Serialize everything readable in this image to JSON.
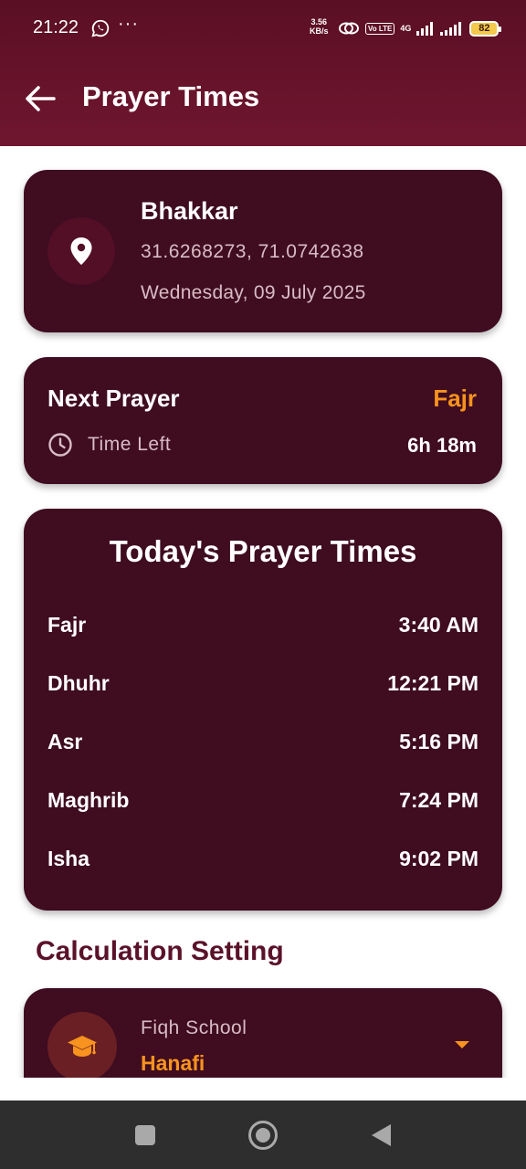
{
  "status_bar": {
    "time": "21:22",
    "more": "···",
    "net_speed_value": "3.56",
    "net_speed_unit": "KB/s",
    "volte_label": "Vo LTE",
    "network_type": "4G",
    "battery_level": "82"
  },
  "header": {
    "title": "Prayer Times"
  },
  "location": {
    "city": "Bhakkar",
    "coordinates": "31.6268273, 71.0742638",
    "date": "Wednesday, 09 July 2025"
  },
  "next_prayer": {
    "label": "Next Prayer",
    "name": "Fajr",
    "time_left_label": "Time Left",
    "time_left_value": "6h 18m"
  },
  "todays_times": {
    "title": "Today's Prayer Times",
    "rows": [
      {
        "name": "Fajr",
        "time": "3:40 AM"
      },
      {
        "name": "Dhuhr",
        "time": "12:21 PM"
      },
      {
        "name": "Asr",
        "time": "5:16 PM"
      },
      {
        "name": "Maghrib",
        "time": "7:24 PM"
      },
      {
        "name": "Isha",
        "time": "9:02 PM"
      }
    ]
  },
  "calculation": {
    "section_title": "Calculation Setting",
    "fiqh_label": "Fiqh School",
    "fiqh_value": "Hanafi"
  },
  "colors": {
    "header_bg": "#701630",
    "card_bg": "#3f0c20",
    "accent_orange": "#f7931e",
    "section_title": "#5a1229"
  },
  "icons": {
    "back": "arrow-left-icon",
    "location": "location-pin-icon",
    "clock": "clock-icon",
    "fiqh": "graduation-cap-icon",
    "dropdown": "caret-down-icon"
  }
}
